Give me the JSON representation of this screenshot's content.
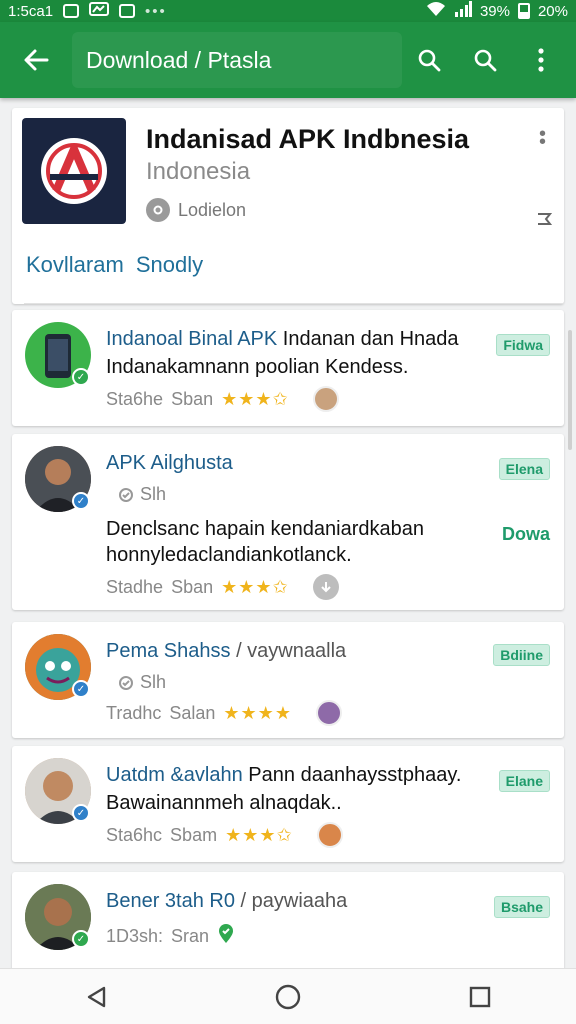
{
  "status_bar": {
    "time": "1:5ca1",
    "battery": "39%",
    "battery2": "20%"
  },
  "app_bar": {
    "title": "Download / Ptasla"
  },
  "header_card": {
    "title": "Indanisad APK Indbnesia",
    "subtitle": "Indonesia",
    "meta": "Lodielon",
    "tabs": [
      "Kovllaram",
      "Snodly"
    ]
  },
  "items": [
    {
      "title_highlight": "Indanoal Binal APK",
      "title_rest": " Indanan dan Hnada",
      "line2": "Indanakamnann poolian Kendess.",
      "foot_label": "Sta6he",
      "foot_label2": "Sban",
      "stars": "★★★✩",
      "rating": 3.5,
      "badge": "Fidwa"
    },
    {
      "title_highlight": "APK Ailghusta",
      "sub": "Slh",
      "line2": "Denclsanc hapain kendaniardkaban",
      "line3": "honnyledaclandiankotlanck.",
      "foot_label": "Stadhe",
      "foot_label2": "Sban",
      "stars": "★★★✩",
      "rating": 3.5,
      "badge": "Elena",
      "badge2": "Dowa"
    },
    {
      "title_highlight": "Pema Shahss",
      "title_alt": " / vaywnaalla",
      "sub": "Slh",
      "foot_label": "Tradhc",
      "foot_label2": "Salan",
      "stars": "★★★★",
      "rating": 4,
      "badge": "Bdiine"
    },
    {
      "title_highlight": "Uatdm &avlahn",
      "title_rest": " Pann daanhaysstphaay.",
      "line2": "Bawainannmeh alnaqdak..",
      "foot_label": "Sta6hc",
      "foot_label2": "Sbam",
      "stars": "★★★✩",
      "rating": 3.5,
      "badge": "Elane"
    },
    {
      "title_highlight": "Bener 3tah R0",
      "title_alt": " / paywiaaha",
      "foot_label": "1D3sh:",
      "foot_label2": "Sran",
      "badge": "Bsahe"
    }
  ],
  "colors": {
    "primary": "#1f9244",
    "status": "#1b8a3c",
    "accent_text": "#1d5d8a",
    "badge_bg": "#cdeee0",
    "star": "#f0b41c"
  }
}
